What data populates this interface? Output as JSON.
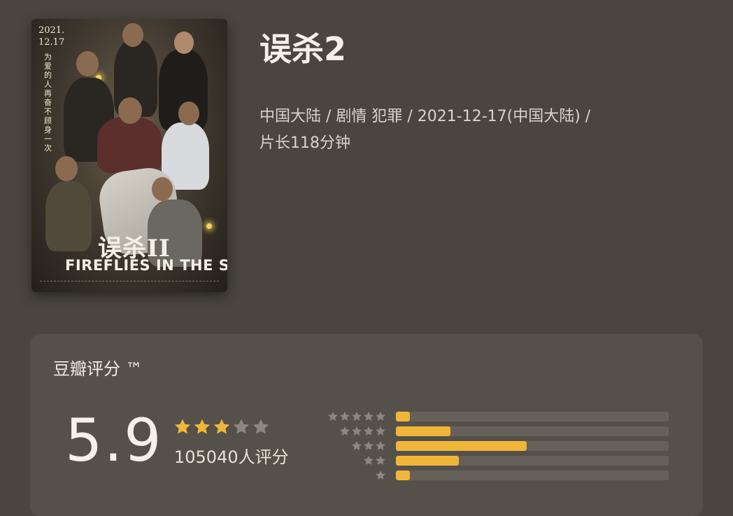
{
  "movie": {
    "title": "误杀2",
    "meta_line1": "中国大陆 / 剧情 犯罪 / 2021-12-17(中国大陆) /",
    "meta_line2": "片长118分钟"
  },
  "poster": {
    "date": "2021.\n12.17",
    "tagline": "为爱的人 再奋不顾身一次",
    "title_cn": "误杀II",
    "title_en": "FIREFLIES IN THE SUN"
  },
  "rating": {
    "label": "豆瓣评分 ™",
    "score": "5.9",
    "stars_filled": 3,
    "stars_total": 5,
    "count": "105040人评分",
    "distribution": [
      {
        "stars": 5,
        "fraction": 0.05
      },
      {
        "stars": 4,
        "fraction": 0.2
      },
      {
        "stars": 3,
        "fraction": 0.48
      },
      {
        "stars": 2,
        "fraction": 0.23
      },
      {
        "stars": 1,
        "fraction": 0.05
      }
    ]
  },
  "colors": {
    "background": "#4a453f",
    "card": "#56504a",
    "star_filled": "#f0b63a",
    "star_empty": "#8d877f",
    "bar_track": "#66605a",
    "bar_fill": "#f0b63a"
  },
  "icons": {
    "star": "star-icon"
  }
}
